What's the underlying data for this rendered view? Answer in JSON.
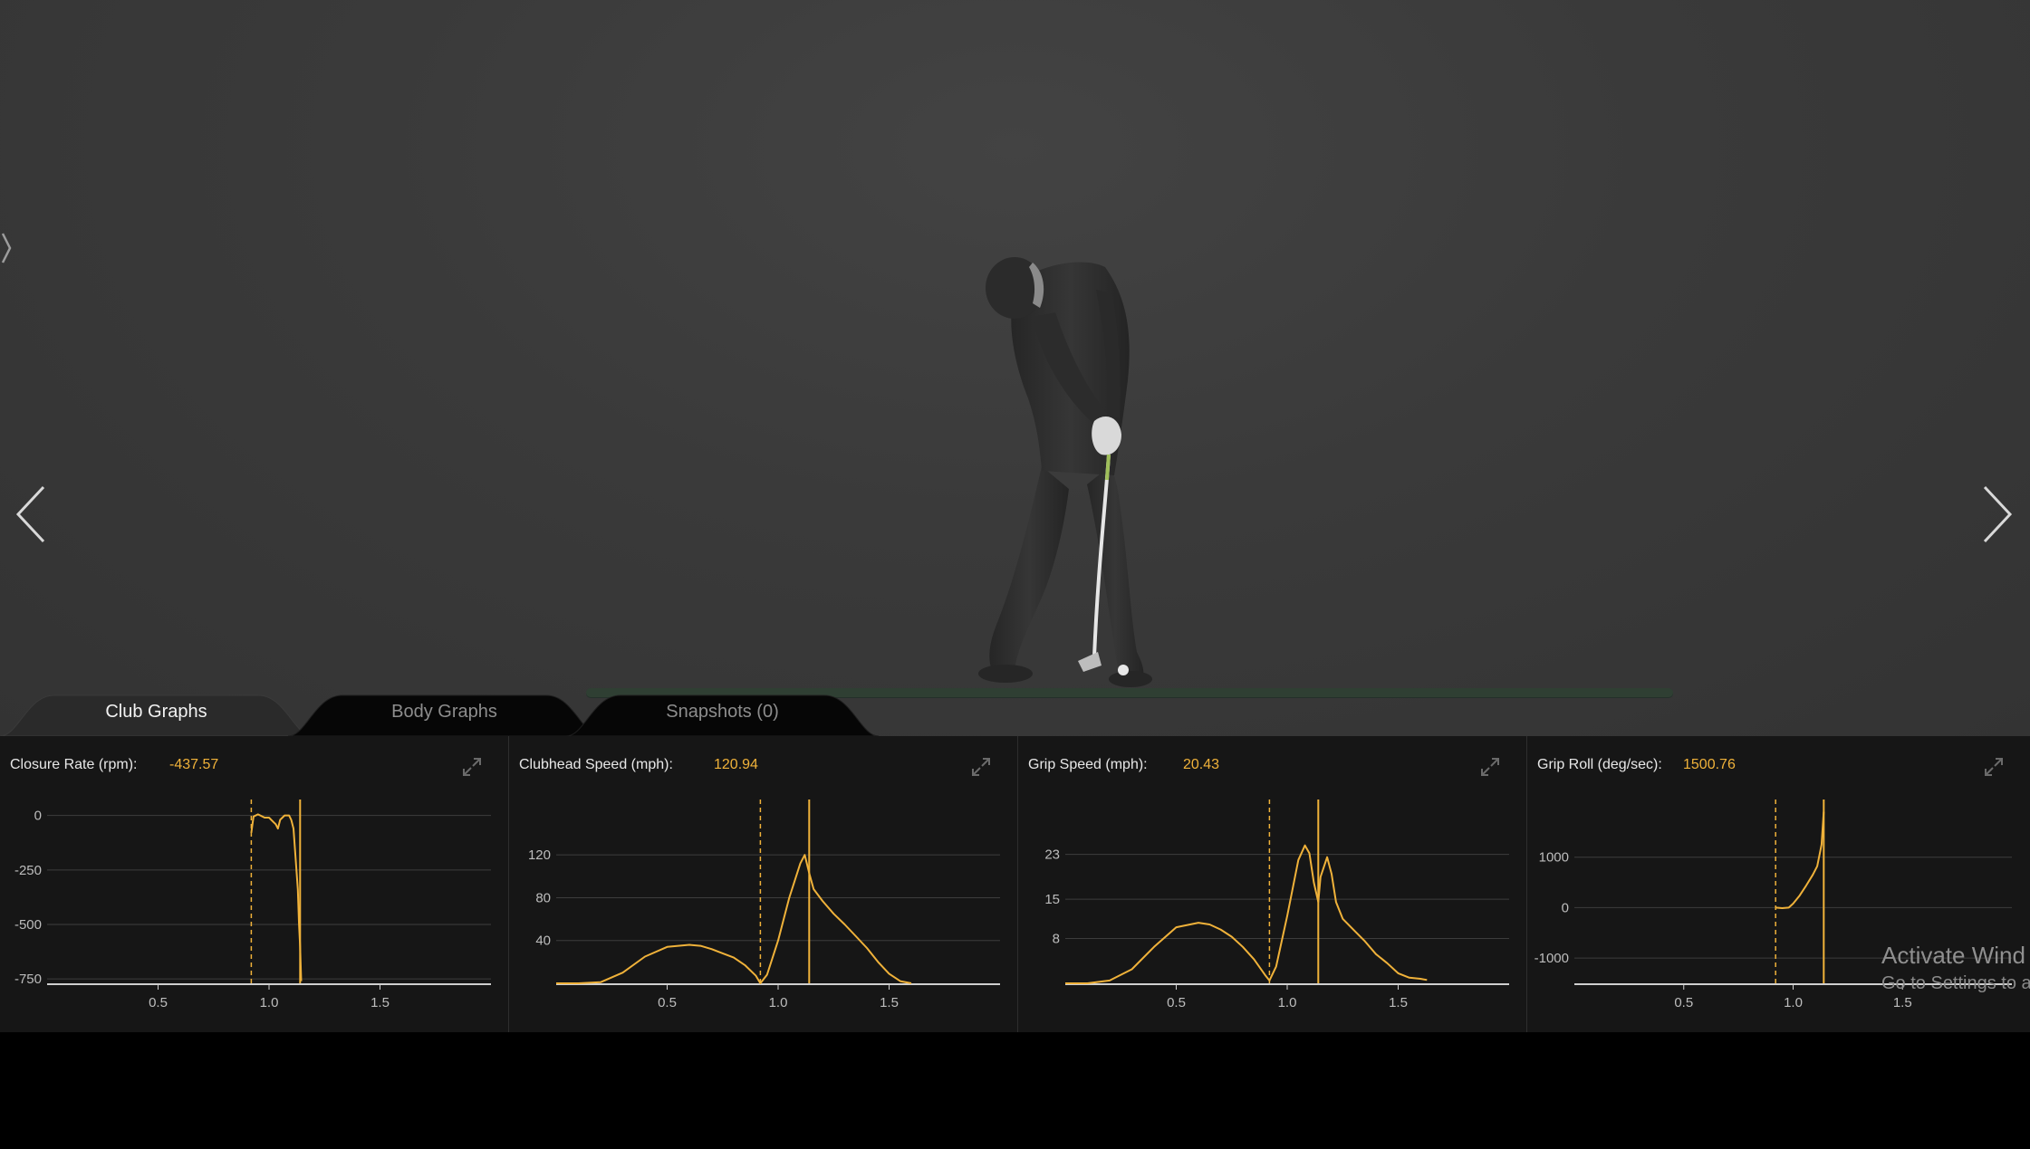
{
  "tabs": [
    {
      "label": "Club Graphs",
      "active": true
    },
    {
      "label": "Body Graphs",
      "active": false
    },
    {
      "label": "Snapshots (0)",
      "active": false
    }
  ],
  "colors": {
    "accent": "#f0b23a",
    "panel_bg": "#161616",
    "viewport_bg": "#3b3b3b",
    "grid": "#3d3d3d",
    "axis": "#cfcfcf"
  },
  "icons": {
    "side_toggle": "chevron-right-icon",
    "prev": "chevron-left-icon",
    "next": "chevron-right-icon",
    "expand": "expand-icon"
  },
  "watermark": {
    "title": "Activate Wind",
    "subtitle": "Go to Settings to a"
  },
  "panels": [
    {
      "title": "Closure Rate (rpm):",
      "value": "-437.57"
    },
    {
      "title": "Clubhead Speed (mph):",
      "value": "120.94"
    },
    {
      "title": "Grip Speed (mph):",
      "value": "20.43"
    },
    {
      "title": "Grip Roll (deg/sec):",
      "value": "1500.76"
    }
  ],
  "chart_data": [
    {
      "type": "line",
      "title": "Closure Rate (rpm):",
      "xlim": [
        0,
        2.0
      ],
      "ylim": [
        -770,
        40
      ],
      "xticks": [
        0.5,
        1.0,
        1.5
      ],
      "xtick_labels": [
        "0.5",
        "1.0",
        "1.5"
      ],
      "yticks": [
        0,
        -250,
        -500,
        -750
      ],
      "ytick_labels": [
        "0",
        "-250",
        "-500",
        "-750"
      ],
      "grid": true,
      "markers": [
        {
          "x": 0.92,
          "style": "dashed"
        },
        {
          "x": 1.14,
          "style": "solid"
        }
      ],
      "series": [
        {
          "x": [
            0.92,
            0.93,
            0.95,
            0.98,
            1.0,
            1.02,
            1.03,
            1.04,
            1.05,
            1.07,
            1.09,
            1.1,
            1.11,
            1.12,
            1.13,
            1.135,
            1.14,
            1.145
          ],
          "y": [
            -80,
            -5,
            5,
            -10,
            -10,
            -30,
            -40,
            -60,
            -20,
            0,
            0,
            -20,
            -60,
            -200,
            -340,
            -500,
            -600,
            -760
          ]
        }
      ]
    },
    {
      "type": "line",
      "title": "Clubhead Speed (mph):",
      "xlim": [
        0,
        2.0
      ],
      "ylim": [
        0,
        165
      ],
      "xticks": [
        0.5,
        1.0,
        1.5
      ],
      "xtick_labels": [
        "0.5",
        "1.0",
        "1.5"
      ],
      "yticks": [
        40,
        80,
        120
      ],
      "ytick_labels": [
        "40",
        "80",
        "120"
      ],
      "grid": true,
      "markers": [
        {
          "x": 0.92,
          "style": "dashed"
        },
        {
          "x": 1.14,
          "style": "solid"
        }
      ],
      "series": [
        {
          "x": [
            0,
            0.1,
            0.2,
            0.3,
            0.4,
            0.5,
            0.6,
            0.65,
            0.7,
            0.75,
            0.8,
            0.85,
            0.9,
            0.92,
            0.95,
            1.0,
            1.05,
            1.1,
            1.12,
            1.14,
            1.16,
            1.2,
            1.25,
            1.3,
            1.35,
            1.4,
            1.45,
            1.5,
            1.55,
            1.6
          ],
          "y": [
            0,
            0,
            1,
            10,
            25,
            34,
            36,
            35,
            32,
            28,
            24,
            17,
            7,
            0,
            8,
            40,
            80,
            112,
            120,
            103,
            88,
            77,
            65,
            55,
            44,
            33,
            20,
            9,
            2,
            0
          ]
        }
      ]
    },
    {
      "type": "line",
      "title": "Grip Speed (mph):",
      "xlim": [
        0,
        2.0
      ],
      "ylim": [
        0,
        31.5
      ],
      "xticks": [
        0.5,
        1.0,
        1.5
      ],
      "xtick_labels": [
        "0.5",
        "1.0",
        "1.5"
      ],
      "yticks": [
        8,
        15,
        23
      ],
      "ytick_labels": [
        "8",
        "15",
        "23"
      ],
      "grid": true,
      "markers": [
        {
          "x": 0.92,
          "style": "dashed"
        },
        {
          "x": 1.14,
          "style": "solid"
        }
      ],
      "series": [
        {
          "x": [
            0,
            0.1,
            0.2,
            0.3,
            0.4,
            0.5,
            0.6,
            0.65,
            0.7,
            0.75,
            0.8,
            0.85,
            0.9,
            0.92,
            0.95,
            1.0,
            1.05,
            1.08,
            1.1,
            1.12,
            1.14,
            1.15,
            1.18,
            1.2,
            1.22,
            1.25,
            1.3,
            1.35,
            1.4,
            1.45,
            1.5,
            1.55,
            1.6,
            1.63
          ],
          "y": [
            0,
            0,
            0.5,
            2.5,
            6.5,
            10,
            10.8,
            10.5,
            9.6,
            8.3,
            6.5,
            4.3,
            1.5,
            0.5,
            3,
            12,
            22,
            24.6,
            23.2,
            18,
            14.5,
            19,
            22.5,
            19.5,
            14.5,
            11.5,
            9.5,
            7.5,
            5.2,
            3.6,
            1.8,
            1,
            0.8,
            0.6
          ]
        }
      ]
    },
    {
      "type": "line",
      "title": "Grip Roll (deg/sec):",
      "xlim": [
        0,
        2.0
      ],
      "ylim": [
        -1500,
        2000
      ],
      "xticks": [
        0.5,
        1.0,
        1.5
      ],
      "xtick_labels": [
        "0.5",
        "1.0",
        "1.5"
      ],
      "yticks": [
        1000,
        0,
        -1000
      ],
      "ytick_labels": [
        "1000",
        "0",
        "-1000"
      ],
      "grid": true,
      "markers": [
        {
          "x": 0.92,
          "style": "dashed"
        },
        {
          "x": 1.14,
          "style": "solid"
        }
      ],
      "series": [
        {
          "x": [
            0.92,
            0.95,
            0.98,
            1.0,
            1.03,
            1.06,
            1.09,
            1.11,
            1.13,
            1.14
          ],
          "y": [
            0,
            -10,
            0,
            80,
            240,
            440,
            650,
            820,
            1250,
            1900
          ]
        }
      ]
    }
  ]
}
